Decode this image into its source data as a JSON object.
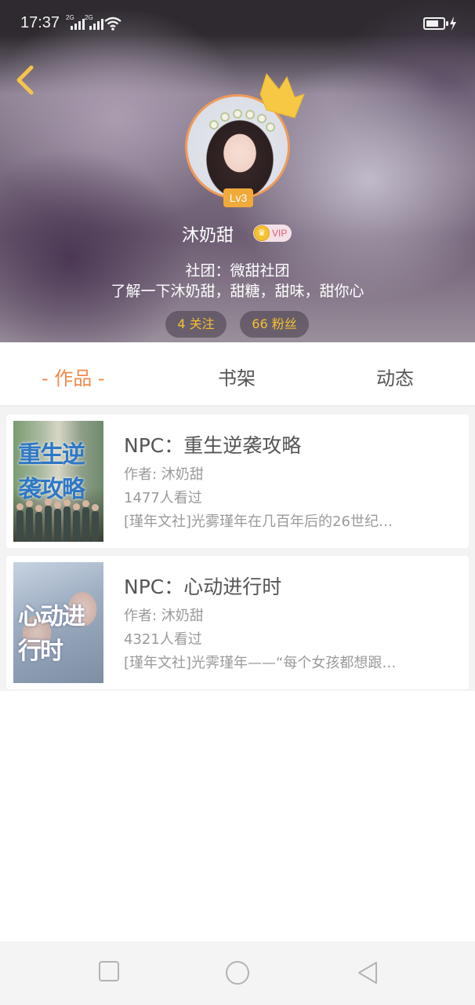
{
  "status_bar": {
    "time": "17:37",
    "signal_1_label": "2G",
    "signal_2_label": "2G"
  },
  "profile": {
    "level": "Lv3",
    "name": "沐奶甜",
    "vip_label": "VIP",
    "club": "社团：微甜社团",
    "description": "了解一下沐奶甜，甜糖，甜味，甜你心",
    "following": "4 关注",
    "fans": "66 粉丝"
  },
  "tabs": [
    {
      "label": "- 作品 -",
      "active": true
    },
    {
      "label": "书架",
      "active": false
    },
    {
      "label": "动态",
      "active": false
    }
  ],
  "works": [
    {
      "title": "NPC：重生逆袭攻略",
      "author": "作者: 沐奶甜",
      "views": "1477人看过",
      "summary": "[瑾年文社]光雾瑾年在几百年后的26世纪…",
      "cover_text": "重生逆袭攻略"
    },
    {
      "title": "NPC：心动进行时",
      "author": "作者: 沐奶甜",
      "views": "4321人看过",
      "summary": "[瑾年文社]光霁瑾年——“每个女孩都想跟…",
      "cover_text": "心动进行时"
    }
  ],
  "colors": {
    "accent": "#f08a4b",
    "stat_text": "#f4c02f",
    "level_badge": "#f1a93a",
    "vip_text": "#e65a74"
  },
  "icons": {
    "back": "chevron-left-icon",
    "crown": "crown-icon",
    "nav_recent": "square-icon",
    "nav_home": "circle-icon",
    "nav_back": "triangle-left-icon"
  }
}
